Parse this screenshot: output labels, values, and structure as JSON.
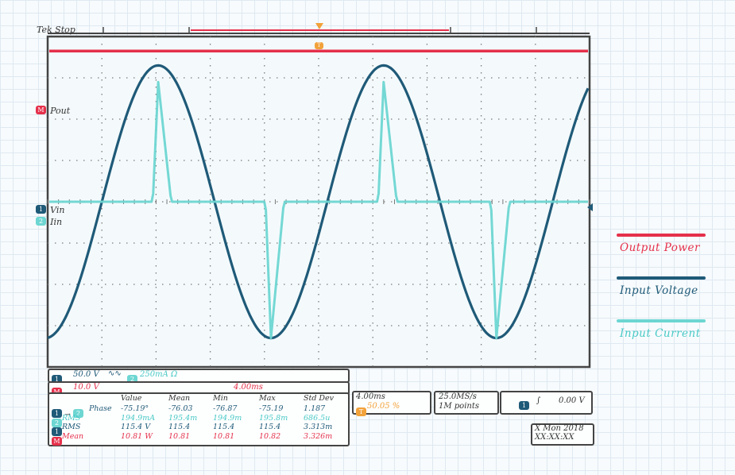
{
  "status": {
    "label": "Tek Stop"
  },
  "colors": {
    "output_power": "#e5304b",
    "input_voltage": "#1f5a78",
    "input_current": "#6dd6d2",
    "trigger": "#f2a23a"
  },
  "channel_markers": {
    "math": {
      "chip": "M",
      "label": "Pout"
    },
    "ch1": {
      "chip": "1",
      "label": "Vin"
    },
    "ch2": {
      "chip": "2",
      "label": "Iin"
    },
    "trigger_chip": "T"
  },
  "scale_box": {
    "ch1_chip": "1",
    "ch1_scale": "50.0 V",
    "ch1_coupling": "∿∿",
    "ch2_chip": "2",
    "ch2_scale": "250mA Ω",
    "math_chip": "M",
    "math_scale": "10.0 V",
    "math_time": "4.00ms"
  },
  "measurements": {
    "headers": [
      "Value",
      "Mean",
      "Min",
      "Max",
      "Std Dev"
    ],
    "rows": [
      {
        "chip": "1",
        "chip2": "2",
        "arrow": "→",
        "label": "Phase",
        "values": [
          "-75.19°",
          "-76.03",
          "-76.87",
          "-75.19",
          "1.187"
        ]
      },
      {
        "chip": "2",
        "label": "RMS",
        "values": [
          "194.9mA",
          "195.4m",
          "194.9m",
          "195.8m",
          "686.5u"
        ]
      },
      {
        "chip": "1",
        "label": "RMS",
        "values": [
          "115.4 V",
          "115.4",
          "115.4",
          "115.4",
          "3.313m"
        ]
      },
      {
        "chip": "M",
        "label": "Mean",
        "values": [
          "10.81 W",
          "10.81",
          "10.81",
          "10.82",
          "3.326m"
        ]
      }
    ]
  },
  "horizontal": {
    "time_div": "4.00ms",
    "trigger_chip": "T",
    "trigger_pos": "50.05 %"
  },
  "acquisition": {
    "rate": "25.0MS/s",
    "points": "1M points"
  },
  "trigger_box": {
    "chip": "1",
    "slope": "∫",
    "level": "0.00 V"
  },
  "datetime": {
    "date": "X Mon 2018",
    "time": "XX:XX:XX"
  },
  "legend": {
    "output_power": "Output Power",
    "input_voltage": "Input Voltage",
    "input_current": "Input Current"
  },
  "chart_data": {
    "type": "line",
    "title": "",
    "xlabel": "",
    "ylabel": "",
    "grid": true,
    "divisions": {
      "x": 10,
      "y": 8
    },
    "time_per_div_ms": 4.0,
    "legend_placement": "right",
    "series": [
      {
        "name": "Output Power",
        "kind": "flat",
        "level_div": 3.65,
        "color": "#e5304b"
      },
      {
        "name": "Input Voltage",
        "kind": "sine",
        "amplitude_div": 3.3,
        "period_div": 4.16,
        "zero_div": 1.0,
        "phase": "rising",
        "color": "#1f5a78"
      },
      {
        "name": "Input Current",
        "kind": "pulse",
        "peak_pos_div": 2.9,
        "peak_neg_div": -3.3,
        "pulse_width_div": 0.35,
        "pulse_centers_div": [
          2.04,
          4.12,
          6.2,
          8.28
        ],
        "color": "#6dd6d2"
      }
    ]
  }
}
